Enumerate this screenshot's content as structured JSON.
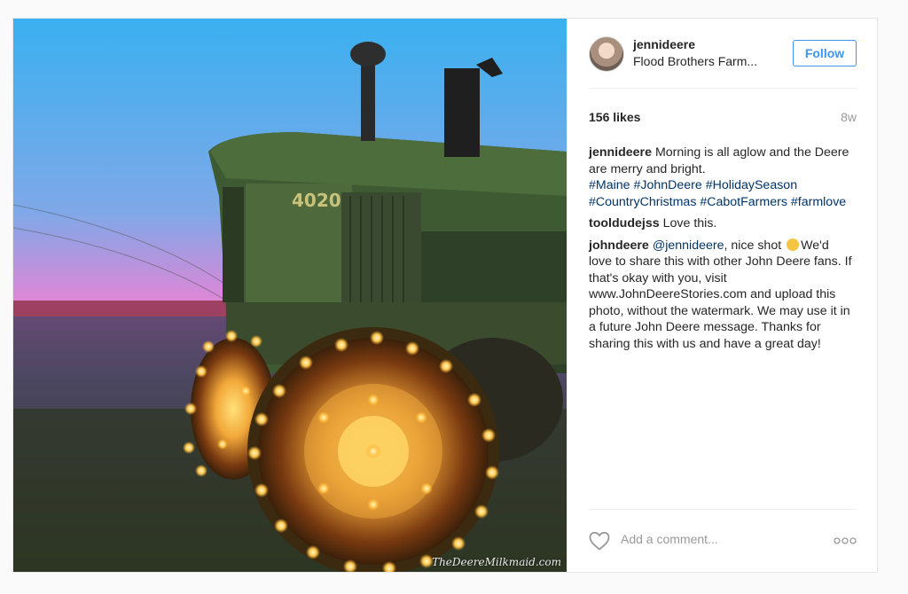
{
  "post": {
    "image": {
      "tractor_model_number": "4020",
      "watermark": "TheDeereMilkmaid.com"
    },
    "header": {
      "username": "jennideere",
      "location": "Flood Brothers Farm...",
      "follow_label": "Follow"
    },
    "stats": {
      "likes": "156 likes",
      "age": "8w"
    },
    "caption": {
      "author": "jennideere",
      "text": "Morning is all aglow and the Deere are merry and bright.",
      "hashtags": [
        "#Maine",
        "#JohnDeere",
        "#HolidaySeason",
        "#CountryChristmas",
        "#CabotFarmers",
        "#farmlove"
      ]
    },
    "comments": [
      {
        "author": "tooldudejss",
        "text": "Love this."
      },
      {
        "author": "johndeere",
        "mention": "@jennideere",
        "text_before_emoji": ", nice shot",
        "emoji": "ok-hand-emoji",
        "text_after_emoji": "We'd love to share this with other John Deere fans. If that's okay with you, visit www.JohnDeereStories.com and upload this photo, without the watermark. We may use it in a future John Deere message. Thanks for sharing this with us and have a great day!"
      }
    ],
    "footer": {
      "comment_placeholder": "Add a comment...",
      "like_icon": "heart-icon",
      "more_icon": "more-options-icon"
    }
  },
  "colors": {
    "link_blue": "#3897f0",
    "hashtag": "#003569",
    "muted": "#999999"
  }
}
